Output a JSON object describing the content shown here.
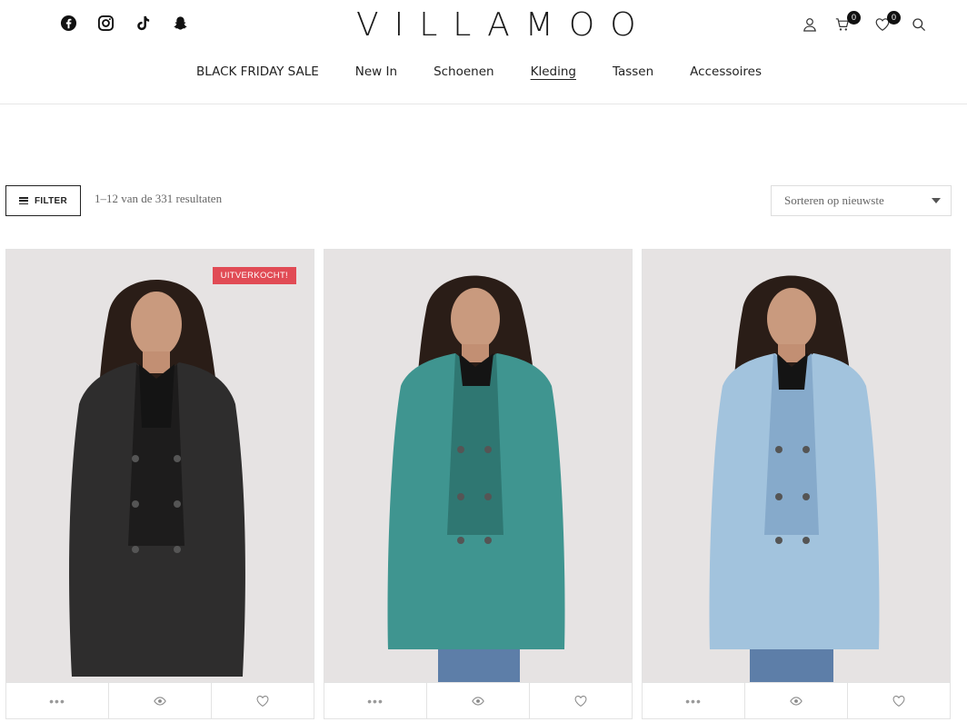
{
  "brand": {
    "logo": "VILLAMOO"
  },
  "socials": [
    {
      "icon": "facebook-icon"
    },
    {
      "icon": "instagram-icon"
    },
    {
      "icon": "tiktok-icon"
    },
    {
      "icon": "snapchat-icon"
    }
  ],
  "utilities": {
    "cart_count": "0",
    "wishlist_count": "0"
  },
  "nav": {
    "items": [
      "BLACK FRIDAY SALE",
      "New In",
      "Schoenen",
      "Kleding",
      "Tassen",
      "Accessoires"
    ],
    "active": "Kleding"
  },
  "toolbar": {
    "filter_label": "FILTER",
    "results_text": "1–12 van de 331 resultaten",
    "sort_value": "Sorteren op nieuwste"
  },
  "products": [
    {
      "badge": "UITVERKOCHT!",
      "coat_color": "#2e2d2d",
      "coat_shade": "#1d1c1c"
    },
    {
      "badge": "",
      "coat_color": "#3f9590",
      "coat_shade": "#2f7772"
    },
    {
      "badge": "",
      "coat_color": "#a2c3dd",
      "coat_shade": "#86aacb"
    }
  ],
  "colors": {
    "badge": "#e14b55",
    "text": "#222222",
    "muted": "#666666"
  }
}
